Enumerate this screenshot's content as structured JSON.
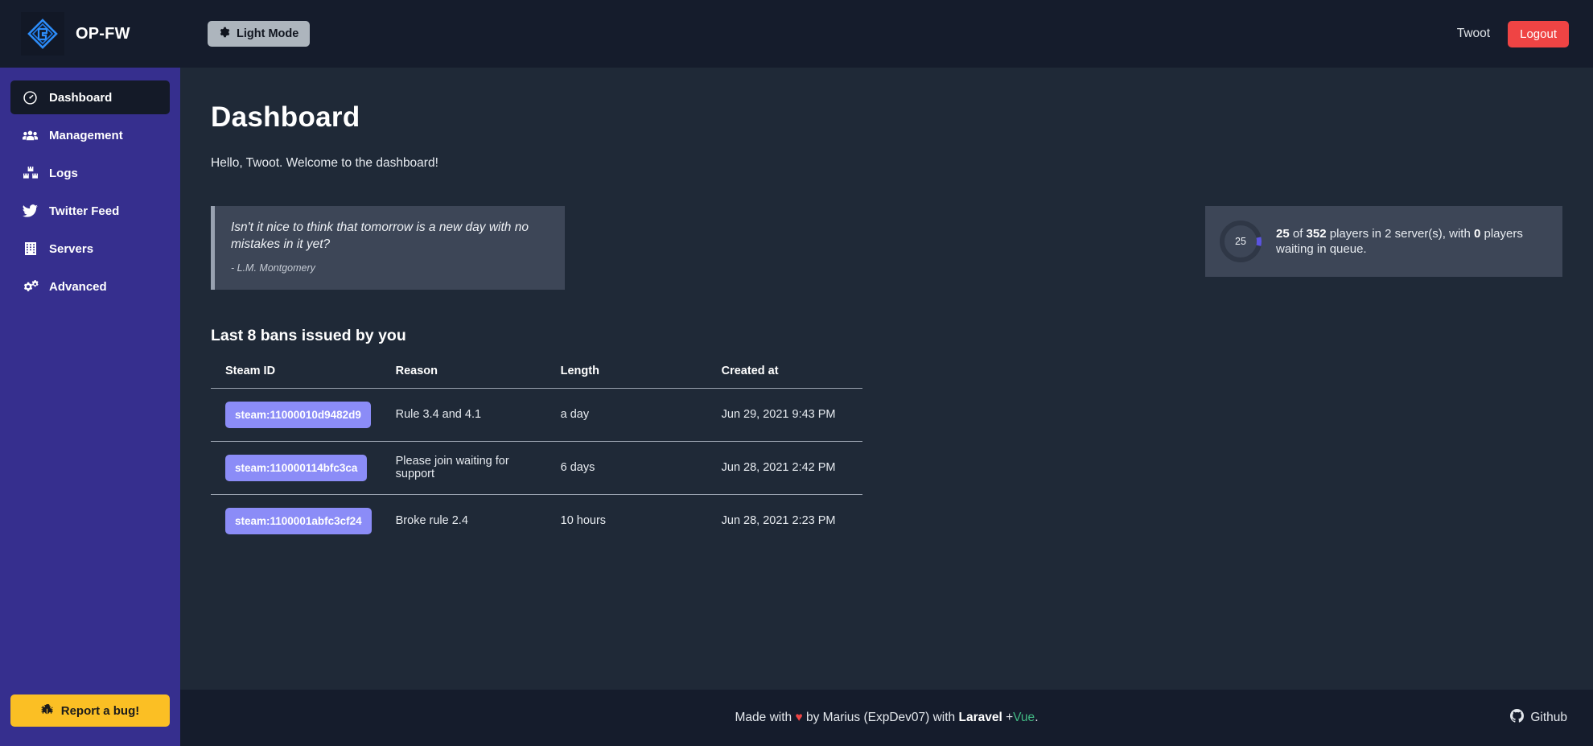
{
  "brand": {
    "name": "OP-FW",
    "logo_icon": "opfw-diamond-logo"
  },
  "topbar": {
    "light_mode_label": "Light Mode",
    "light_mode_icon": "gear-icon",
    "user_name": "Twoot",
    "logout_label": "Logout"
  },
  "sidebar": {
    "items": [
      {
        "label": "Dashboard",
        "icon": "gauge-icon",
        "active": true
      },
      {
        "label": "Management",
        "icon": "users-icon",
        "active": false
      },
      {
        "label": "Logs",
        "icon": "boxes-icon",
        "active": false
      },
      {
        "label": "Twitter Feed",
        "icon": "twitter-icon",
        "active": false
      },
      {
        "label": "Servers",
        "icon": "server-grid-icon",
        "active": false
      },
      {
        "label": "Advanced",
        "icon": "double-gear-icon",
        "active": false
      }
    ],
    "bug_button": {
      "label": "Report a bug!",
      "icon": "bug-icon"
    }
  },
  "main": {
    "title": "Dashboard",
    "welcome": "Hello, Twoot. Welcome to the dashboard!",
    "quote": {
      "text": "Isn't it nice to think that tomorrow is a new day with no mistakes in it yet?",
      "author": "- L.M. Montgomery"
    },
    "stats": {
      "donut_value": "25",
      "online": "25",
      "slots": "352",
      "of_word": "of",
      "mid_text": "players in 2 server(s), with",
      "queue": "0",
      "tail_text": "players waiting in queue."
    },
    "bans": {
      "section_title": "Last 8 bans issued by you",
      "columns": [
        "Steam ID",
        "Reason",
        "Length",
        "Created at"
      ],
      "rows": [
        {
          "steam_id": "steam:11000010d9482d9",
          "reason": "Rule 3.4 and 4.1",
          "length": "a day",
          "created_at": "Jun 29, 2021 9:43 PM"
        },
        {
          "steam_id": "steam:110000114bfc3ca",
          "reason": "Please join waiting for support",
          "length": "6 days",
          "created_at": "Jun 28, 2021 2:42 PM"
        },
        {
          "steam_id": "steam:1100001abfc3cf24",
          "reason": "Broke rule 2.4",
          "length": "10 hours",
          "created_at": "Jun 28, 2021 2:23 PM"
        }
      ]
    }
  },
  "footer": {
    "made_with": "Made with",
    "heart": "♥",
    "by_text": "by Marius (ExpDev07) with",
    "laravel": "Laravel",
    "plus": "+",
    "vue": "Vue",
    "period": ".",
    "github_label": "Github",
    "github_icon": "github-icon"
  },
  "colors": {
    "sidebar": "#362f8e",
    "topbar": "#151c2c",
    "content": "#1f2937",
    "card": "#3d4657",
    "accent_purple": "#8b8cf7",
    "danger": "#ef4444",
    "warning": "#fbbf24",
    "vue_green": "#41b883"
  }
}
